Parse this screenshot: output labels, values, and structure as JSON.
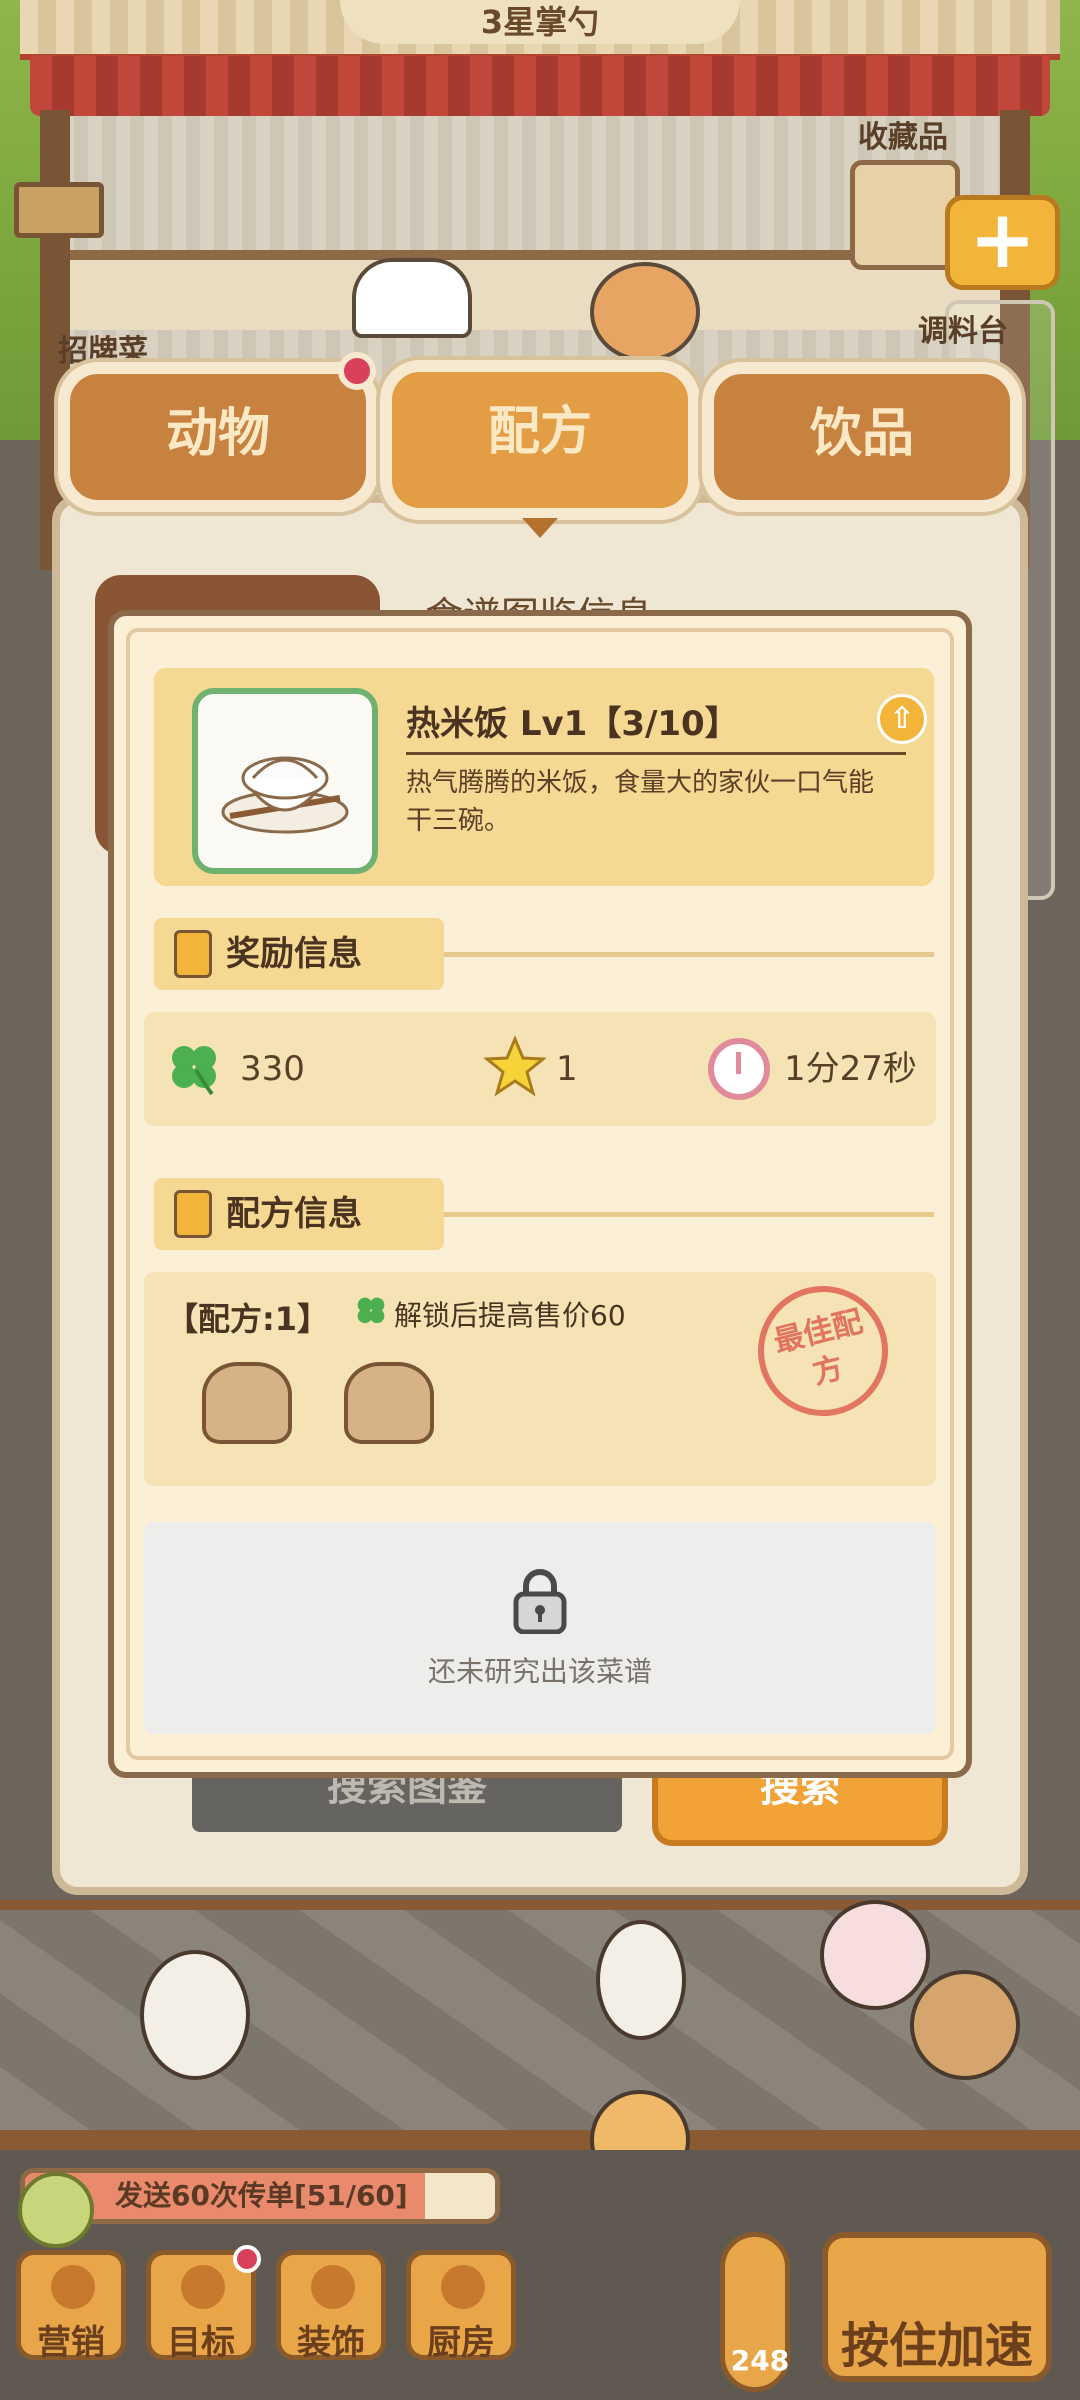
{
  "scene": {
    "shop_title": "3星掌勺",
    "collection_label": "收藏品",
    "signature_label": "招牌菜",
    "seasoning_label": "调料台",
    "plus_label": "+"
  },
  "tabs": [
    {
      "label": "动物",
      "badge": true
    },
    {
      "label": "配方",
      "active": true
    },
    {
      "label": "饮品"
    }
  ],
  "book": {
    "header": "食谱图鉴信息",
    "search_box": "搜索图鉴",
    "search_button": "搜索"
  },
  "modal": {
    "item": {
      "name": "热米饭 Lv1【3/10】",
      "description": "热气腾腾的米饭，食量大的家伙一口气能干三碗。"
    },
    "reward_section_title": "奖励信息",
    "rewards": {
      "clover": "330",
      "star": "1",
      "time": "1分27秒"
    },
    "recipe_section_title": "配方信息",
    "recipe": {
      "count_label": "【配方:1】",
      "bonus_text": "解锁后提高售价60",
      "stamp_text": "最佳配方"
    },
    "locked_text": "还未研究出该菜谱"
  },
  "bottom": {
    "quest_text": "发送60次传单[51/60]",
    "quest_progress": 0.85,
    "nav": [
      {
        "label": "营销"
      },
      {
        "label": "目标",
        "badge": true
      },
      {
        "label": "装饰"
      },
      {
        "label": "厨房"
      }
    ],
    "thermometer_value": "248",
    "speed_button": "按住加速"
  },
  "colors": {
    "panel_bg": "#fbefd6",
    "card_yellow": "#f5d891",
    "tab_orange": "#e39d45",
    "badge_red": "#d9415a"
  }
}
